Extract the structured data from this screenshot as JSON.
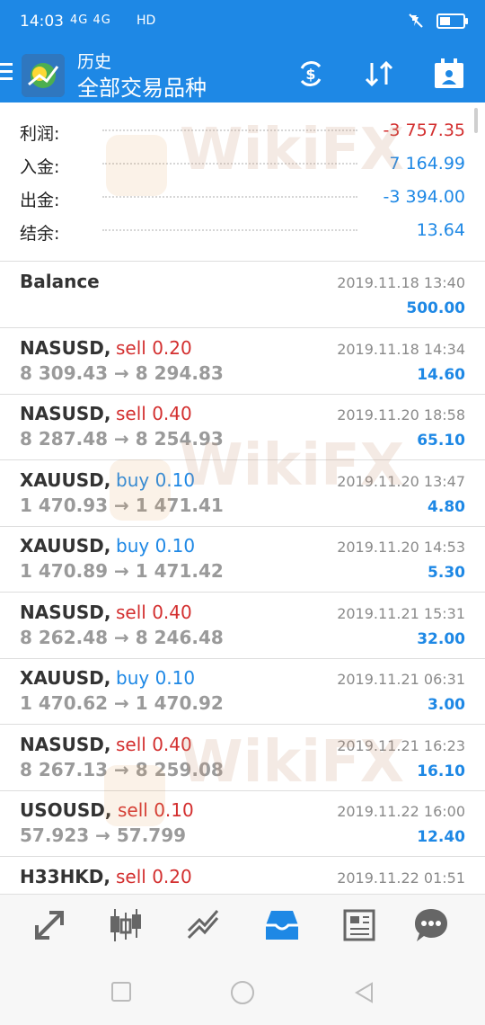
{
  "status_bar": {
    "time": "14:03",
    "signal": "4G 4G",
    "hd": "HD",
    "battery_level": 0.45
  },
  "app_bar": {
    "title": "历史",
    "subtitle": "全部交易品种",
    "icons": [
      "menu-icon",
      "app-logo-icon",
      "currency-exchange-icon",
      "sort-icon",
      "calendar-icon"
    ]
  },
  "summary": [
    {
      "label": "利润:",
      "value": "-3 757.35",
      "color": "#d32f2f"
    },
    {
      "label": "入金:",
      "value": "7 164.99",
      "color": "#1e88e5"
    },
    {
      "label": "出金:",
      "value": "-3 394.00",
      "color": "#1e88e5"
    },
    {
      "label": "结余:",
      "value": "13.64",
      "color": "#1e88e5"
    }
  ],
  "balance_entry": {
    "label": "Balance",
    "date": "2019.11.18 13:40",
    "amount": "500.00"
  },
  "deals": [
    {
      "symbol": "NASUSD,",
      "action": "sell 0.20",
      "side": "sell",
      "prices": "8 309.43 → 8 294.83",
      "date": "2019.11.18 14:34",
      "profit": "14.60"
    },
    {
      "symbol": "NASUSD,",
      "action": "sell 0.40",
      "side": "sell",
      "prices": "8 287.48 → 8 254.93",
      "date": "2019.11.20 18:58",
      "profit": "65.10"
    },
    {
      "symbol": "XAUUSD,",
      "action": "buy 0.10",
      "side": "buy",
      "prices": "1 470.93 → 1 471.41",
      "date": "2019.11.20 13:47",
      "profit": "4.80"
    },
    {
      "symbol": "XAUUSD,",
      "action": "buy 0.10",
      "side": "buy",
      "prices": "1 470.89 → 1 471.42",
      "date": "2019.11.20 14:53",
      "profit": "5.30"
    },
    {
      "symbol": "NASUSD,",
      "action": "sell 0.40",
      "side": "sell",
      "prices": "8 262.48 → 8 246.48",
      "date": "2019.11.21 15:31",
      "profit": "32.00"
    },
    {
      "symbol": "XAUUSD,",
      "action": "buy 0.10",
      "side": "buy",
      "prices": "1 470.62 → 1 470.92",
      "date": "2019.11.21 06:31",
      "profit": "3.00"
    },
    {
      "symbol": "NASUSD,",
      "action": "sell 0.40",
      "side": "sell",
      "prices": "8 267.13 → 8 259.08",
      "date": "2019.11.21 16:23",
      "profit": "16.10"
    },
    {
      "symbol": "USOUSD,",
      "action": "sell 0.10",
      "side": "sell",
      "prices": "57.923 → 57.799",
      "date": "2019.11.22 16:00",
      "profit": "12.40"
    },
    {
      "symbol": "H33HKD,",
      "action": "sell 0.20",
      "side": "sell",
      "prices": "",
      "date": "2019.11.22 01:51",
      "profit": ""
    }
  ],
  "watermark": "WikiFX",
  "colors": {
    "accent": "#1e88e5",
    "sell": "#d32f2f",
    "buy": "#1e88e5",
    "profit": "#1e88e5"
  },
  "bottom_nav": [
    "quotes-icon",
    "chart-icon",
    "trade-icon",
    "history-icon",
    "news-icon",
    "chat-icon"
  ],
  "active_nav": "history-icon"
}
